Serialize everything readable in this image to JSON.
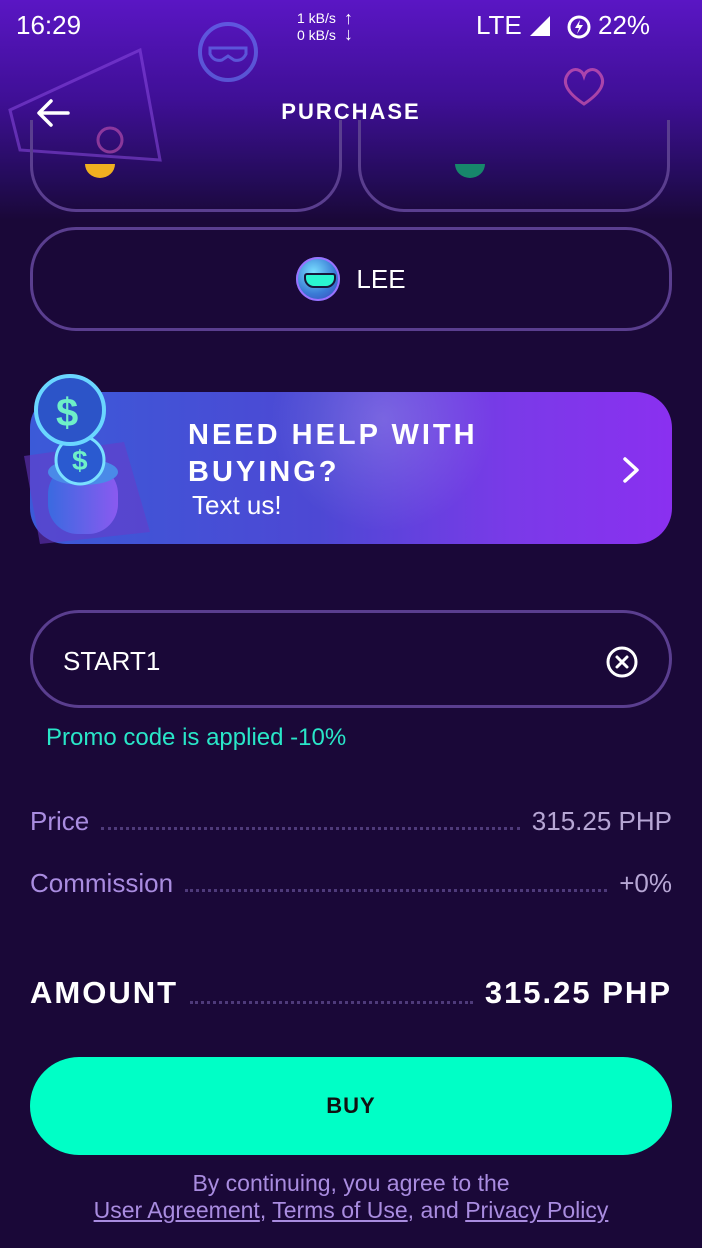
{
  "status_bar": {
    "time": "16:29",
    "net_up": "1 kB/s",
    "net_down": "0 kB/s",
    "network": "LTE",
    "battery": "22%"
  },
  "header": {
    "title": "PURCHASE",
    "back_icon": "arrow-left-icon"
  },
  "options": {
    "selected_label": "LEE"
  },
  "help_banner": {
    "title": "NEED HELP WITH BUYING?",
    "subtitle": "Text us!",
    "icon": "chevron-right-icon"
  },
  "promo": {
    "value": "START1",
    "status": "Promo code is applied -10%",
    "clear_icon": "close-circle-icon"
  },
  "summary": {
    "price_label": "Price",
    "price_value": "315.25 PHP",
    "commission_label": "Commission",
    "commission_value": "+0%",
    "amount_label": "AMOUNT",
    "amount_value": "315.25 PHP"
  },
  "buy_label": "BUY",
  "legal": {
    "prefix": "By continuing, you agree to the",
    "user_agreement": "User Agreement",
    "sep1": ",",
    "terms": "Terms of Use",
    "and": ", and",
    "privacy": "Privacy Policy"
  },
  "colors": {
    "accent": "#00ffc6",
    "promo_ok": "#29e6c8",
    "muted": "#a98ce0",
    "background": "#1a0838"
  }
}
